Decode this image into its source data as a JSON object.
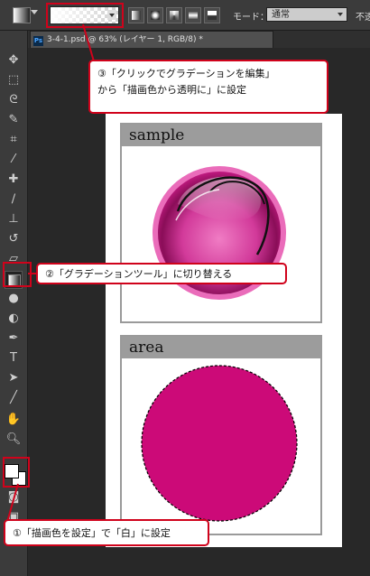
{
  "options_bar": {
    "mode_label": "モード：",
    "mode_value": "通常",
    "opacity_label": "不透"
  },
  "document_tab": {
    "ps_badge": "Ps",
    "title": "3-4-1.psd @ 63% (レイヤー 1, RGB/8) *"
  },
  "panels": {
    "sample_title": "sample",
    "area_title": "area"
  },
  "callouts": {
    "callout3_line1": "③「クリックでグラデーションを編集」",
    "callout3_line2": "から「描画色から透明に」に設定",
    "callout2": "②「グラデーションツール」に切り替える",
    "callout1": "①「描画色を設定」で「白」に設定"
  },
  "colors": {
    "callout_border": "#d0021b",
    "circle_fill": "#cc0a78",
    "sphere_highlight": "#f06cb8"
  }
}
